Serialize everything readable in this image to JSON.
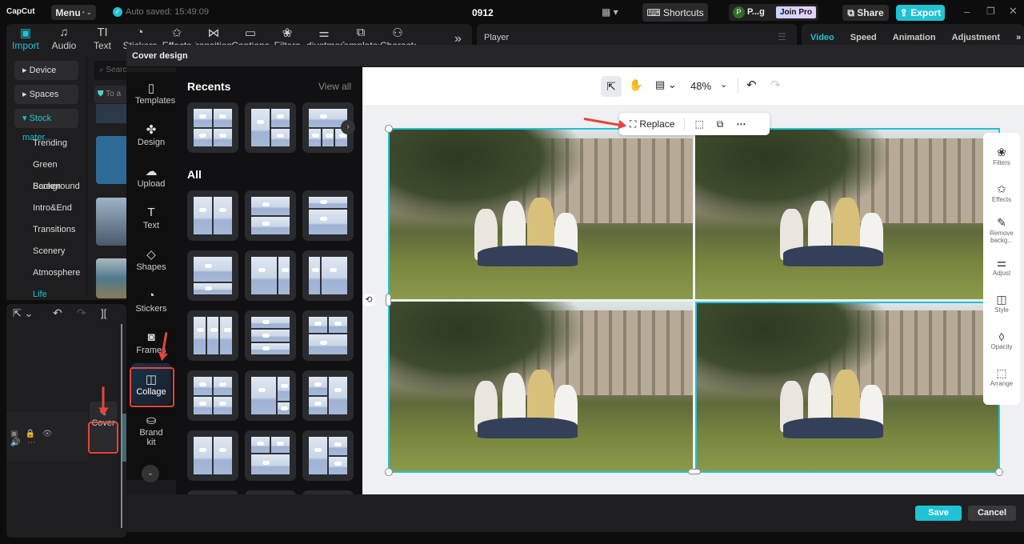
{
  "app": {
    "logo": "CapCut",
    "menu": "Menu",
    "autosave": "Auto saved: 15:49:09",
    "project": "0912",
    "shortcuts": "Shortcuts",
    "user_initial": "P",
    "user_name": "P...g",
    "join_pro": "Join Pro",
    "share": "Share",
    "export": "Export",
    "accent": "#1fc3d3"
  },
  "toolbar": {
    "tabs": [
      {
        "label": "Import",
        "icon": "import-icon",
        "g": "▣"
      },
      {
        "label": "Audio",
        "icon": "audio-icon",
        "g": "♫"
      },
      {
        "label": "Text",
        "icon": "text-icon",
        "g": "TI"
      },
      {
        "label": "Stickers",
        "icon": "sticker-icon",
        "g": "◔"
      },
      {
        "label": "Effects",
        "icon": "effects-icon",
        "g": "✩"
      },
      {
        "label": "Transitions",
        "icon": "transition-icon",
        "g": "⋈"
      },
      {
        "label": "Captions",
        "icon": "captions-icon",
        "g": "▭"
      },
      {
        "label": "Filters",
        "icon": "filters-icon",
        "g": "❀"
      },
      {
        "label": "Adjustment",
        "icon": "adjust-icon",
        "g": "⚌"
      },
      {
        "label": "Templates",
        "icon": "templates-icon",
        "g": "⧉"
      },
      {
        "label": "AI Characters",
        "icon": "ai-icon",
        "g": "⚇"
      }
    ],
    "more": "»"
  },
  "player": {
    "title": "Player"
  },
  "right_tabs": [
    "Video",
    "Speed",
    "Animation",
    "Adjustment"
  ],
  "sidebar": {
    "groups": [
      "Device",
      "Spaces",
      "Stock mater..."
    ],
    "subitems": [
      "Trending",
      "Green Screen",
      "Background",
      "Intro&End",
      "Transitions",
      "Scenery",
      "Atmosphere",
      "Life"
    ],
    "search_placeholder": "Search",
    "notice": "To a"
  },
  "timeline": {
    "cover_label": "Cover"
  },
  "modal": {
    "title": "Cover design",
    "nav": [
      {
        "label": "Templates",
        "g": "▯",
        "icon": "templates-icon"
      },
      {
        "label": "Design",
        "g": "✤",
        "icon": "design-icon"
      },
      {
        "label": "Upload",
        "g": "☁",
        "icon": "upload-icon"
      },
      {
        "label": "Text",
        "g": "T",
        "icon": "text-icon"
      },
      {
        "label": "Shapes",
        "g": "◇",
        "icon": "shapes-icon"
      },
      {
        "label": "Stickers",
        "g": "◔",
        "icon": "sticker-icon"
      },
      {
        "label": "Frames",
        "g": "◙",
        "icon": "frames-icon"
      },
      {
        "label": "Collage",
        "g": "◫",
        "icon": "collage-icon"
      },
      {
        "label": "Brand kit",
        "g": "⛀",
        "icon": "brand-kit-icon"
      }
    ],
    "recents_title": "Recents",
    "view_all": "View all",
    "all_title": "All",
    "recents": [
      "grid4",
      "l1r2",
      "top3"
    ],
    "all": [
      "v2",
      "h2",
      "topsmall",
      "botsmall",
      "leftbig",
      "rightbig",
      "v3",
      "h3",
      "top2bot1",
      "grid4",
      "tlbig",
      "l2r1",
      "v2",
      "top2bot1",
      "l1r2",
      "h2",
      "v2",
      "h2"
    ],
    "zoom": "48%",
    "replace": "Replace",
    "right_tools": [
      {
        "label": "Filters",
        "g": "❀"
      },
      {
        "label": "Effects",
        "g": "✩"
      },
      {
        "label": "Remove backg...",
        "g": "✎"
      },
      {
        "label": "Adjust",
        "g": "⚌"
      },
      {
        "label": "Style",
        "g": "◫"
      },
      {
        "label": "Opacity",
        "g": "◊"
      },
      {
        "label": "Arrange",
        "g": "⬚"
      }
    ],
    "save": "Save",
    "cancel": "Cancel"
  }
}
